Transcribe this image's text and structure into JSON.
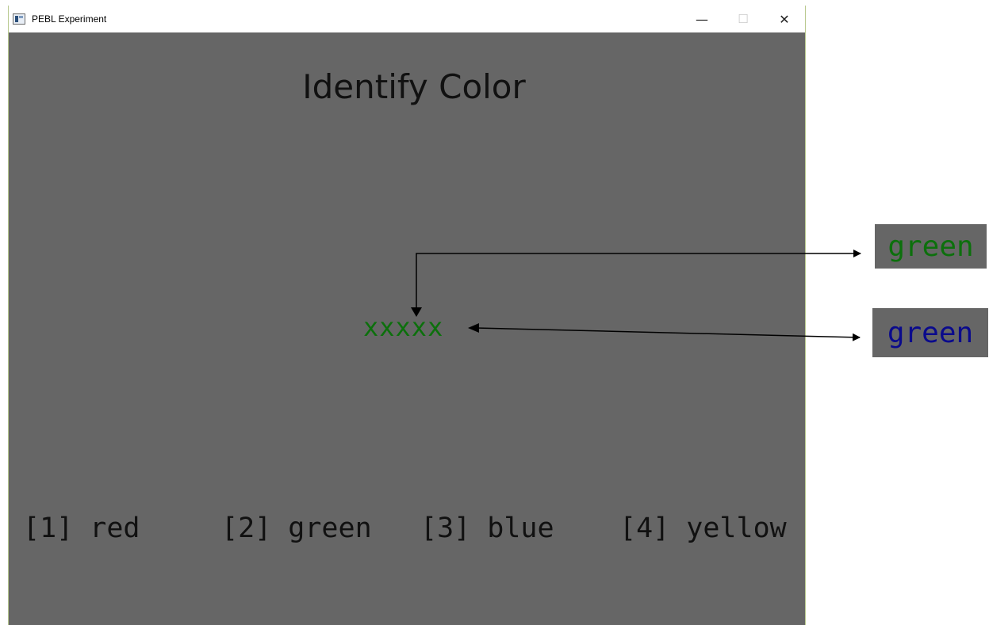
{
  "window": {
    "title": "PEBL Experiment",
    "controls": {
      "minimize": "—",
      "maximize": "☐",
      "close": "✕"
    }
  },
  "screen": {
    "heading": "Identify Color",
    "stimulus": {
      "text": "xxxxx",
      "color": "#0c700c"
    },
    "options": [
      {
        "label": "[1] red"
      },
      {
        "label": "[2] green"
      },
      {
        "label": "[3] blue"
      },
      {
        "label": "[4] yellow"
      }
    ]
  },
  "annotations": {
    "word_callout": {
      "text": "green",
      "color": "#0c700c"
    },
    "ink_callout": {
      "text": "green",
      "color": "#0a0a8c"
    }
  },
  "colors": {
    "background": "#666666",
    "titlebar": "#ffffff",
    "text": "#111111"
  }
}
